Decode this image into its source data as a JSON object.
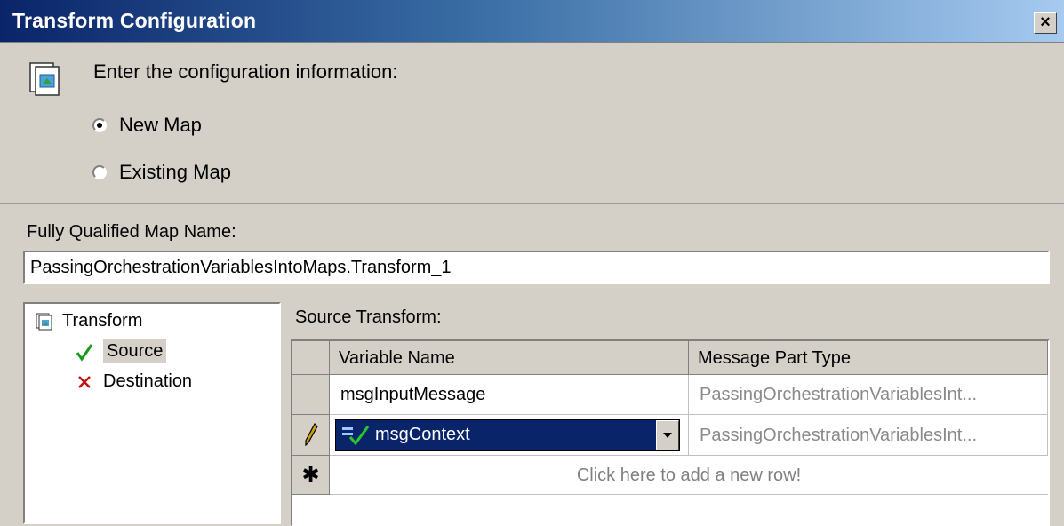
{
  "window": {
    "title": "Transform Configuration",
    "close_label": "×"
  },
  "header": {
    "prompt": "Enter the configuration information:",
    "options": [
      {
        "label": "New Map",
        "selected": true
      },
      {
        "label": "Existing Map",
        "selected": false
      }
    ]
  },
  "map_name": {
    "label": "Fully Qualified Map Name:",
    "value": "PassingOrchestrationVariablesIntoMaps.Transform_1"
  },
  "tree": {
    "root": {
      "label": "Transform",
      "icon": "transform-icon"
    },
    "children": [
      {
        "label": "Source",
        "icon": "checkmark-icon",
        "status_color": "#1a9a1a"
      },
      {
        "label": "Destination",
        "icon": "x-mark-icon",
        "status_color": "#c01010"
      }
    ]
  },
  "source_transform": {
    "label": "Source Transform:",
    "columns": [
      "Variable Name",
      "Message Part Type"
    ],
    "rows": [
      {
        "variable": "msgInputMessage",
        "type": "PassingOrchestrationVariablesInt..."
      },
      {
        "variable": "msgContext",
        "type": "PassingOrchestrationVariablesInt...",
        "editing": true
      }
    ],
    "new_row_text": "Click here to add a new row!"
  },
  "colors": {
    "titlebar_start": "#0a246a",
    "selection": "#0a246a",
    "face": "#d4d0c8"
  }
}
